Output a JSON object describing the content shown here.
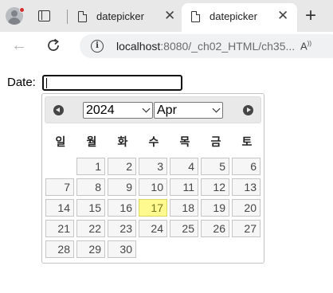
{
  "browser": {
    "tabs": [
      {
        "title": "datepicker",
        "active": false
      },
      {
        "title": "datepicker",
        "active": true
      }
    ],
    "url_host": "localhost",
    "url_rest": ":8080/_ch02_HTML/ch35...",
    "read_aloud": "A͆́"
  },
  "form": {
    "label": "Date:",
    "value": ""
  },
  "datepicker": {
    "year": "2024",
    "month": "Apr",
    "weekdays": [
      "일",
      "월",
      "화",
      "수",
      "목",
      "금",
      "토"
    ],
    "today": 17,
    "first_weekday_index": 1,
    "days_in_month": 30,
    "colors": {
      "today_bg": "#fffa90",
      "day_bg": "#f6f6f6",
      "header_bg": "#e9e9e9"
    }
  }
}
